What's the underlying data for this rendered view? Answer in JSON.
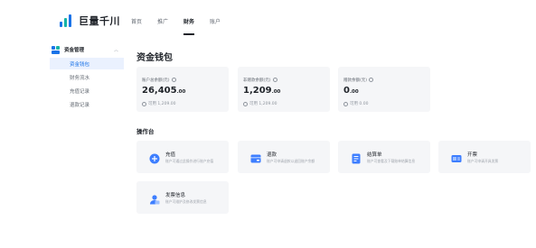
{
  "header": {
    "logo_text": "巨量千川",
    "nav": [
      {
        "label": "首页"
      },
      {
        "label": "推广"
      },
      {
        "label": "财务"
      },
      {
        "label": "账户"
      }
    ],
    "active_nav": "财务"
  },
  "sidebar": {
    "group_label": "资金管理",
    "items": [
      {
        "label": "资金钱包"
      },
      {
        "label": "财务流水"
      },
      {
        "label": "充值记录"
      },
      {
        "label": "退款记录"
      }
    ],
    "active_item": "资金钱包"
  },
  "main": {
    "title": "资金钱包",
    "balances": [
      {
        "label": "账户总余额(元)",
        "value_int": "26,405",
        "value_dec": ".00",
        "avail": "可用 1,209.00"
      },
      {
        "label": "非赠款余额(元)",
        "value_int": "1,209",
        "value_dec": ".00",
        "avail": "可用 1,209.00"
      },
      {
        "label": "赠款余额(元)",
        "value_int": "0",
        "value_dec": ".00",
        "avail": "可用 0.00"
      }
    ],
    "section_title": "操作台",
    "operations": [
      {
        "title": "充值",
        "desc": "账户可通过此操作进行账户充值",
        "icon": "recharge-icon",
        "color": "#3d7eff"
      },
      {
        "title": "退款",
        "desc": "账户可申请退款以退回账户余额",
        "icon": "refund-icon",
        "color": "#3d7eff"
      },
      {
        "title": "结算单",
        "desc": "账户可查看及下载账单结算信息",
        "icon": "statement-icon",
        "color": "#3d7eff"
      },
      {
        "title": "开票",
        "desc": "账户可申请开具发票",
        "icon": "invoice-icon",
        "color": "#3d7eff"
      },
      {
        "title": "发票信息",
        "desc": "账户可维护及修改发票信息",
        "icon": "invoice-info-icon",
        "color": "#3d7eff"
      }
    ]
  },
  "colors": {
    "accent": "#1a73e8",
    "card_bg": "#f5f6f8"
  }
}
